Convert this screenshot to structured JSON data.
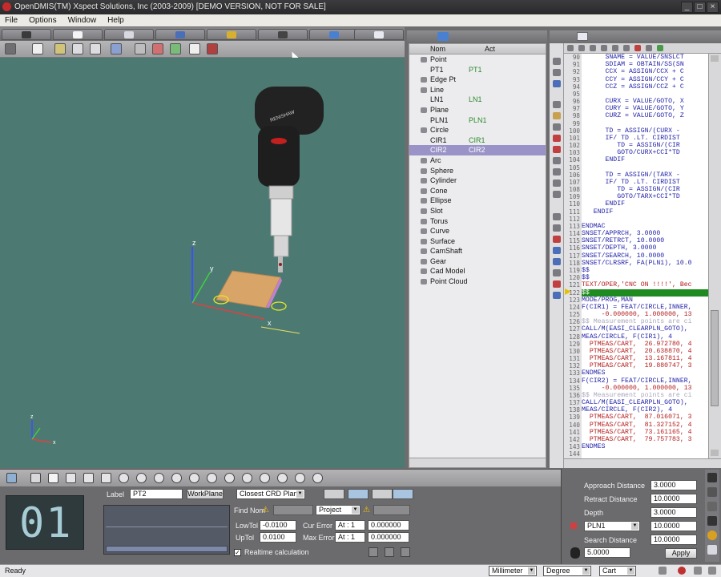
{
  "title": "OpenDMIS(TM) Xspect Solutions, Inc (2003-2009) [DEMO VERSION, NOT FOR SALE]",
  "menu": [
    "File",
    "Options",
    "Window",
    "Help"
  ],
  "tree": {
    "columns": {
      "name": "Nom",
      "act": "Act"
    },
    "rows": [
      {
        "name": "Point",
        "act": ""
      },
      {
        "name": "PT1",
        "act": "PT1"
      },
      {
        "name": "Edge Pt",
        "act": ""
      },
      {
        "name": "Line",
        "act": ""
      },
      {
        "name": "LN1",
        "act": "LN1"
      },
      {
        "name": "Plane",
        "act": ""
      },
      {
        "name": "PLN1",
        "act": "PLN1"
      },
      {
        "name": "Circle",
        "act": ""
      },
      {
        "name": "CIR1",
        "act": "CIR1"
      },
      {
        "name": "CIR2",
        "act": "CIR2"
      },
      {
        "name": "Arc",
        "act": ""
      },
      {
        "name": "Sphere",
        "act": ""
      },
      {
        "name": "Cylinder",
        "act": ""
      },
      {
        "name": "Cone",
        "act": ""
      },
      {
        "name": "Ellipse",
        "act": ""
      },
      {
        "name": "Slot",
        "act": ""
      },
      {
        "name": "Torus",
        "act": ""
      },
      {
        "name": "Curve",
        "act": ""
      },
      {
        "name": "Surface",
        "act": ""
      },
      {
        "name": "CamShaft",
        "act": ""
      },
      {
        "name": "Gear",
        "act": ""
      },
      {
        "name": "Cad Model",
        "act": ""
      },
      {
        "name": "Point Cloud",
        "act": ""
      }
    ]
  },
  "code": {
    "line_numbers": [
      "90",
      "91",
      "92",
      "93",
      "94",
      "95",
      "96",
      "97",
      "98",
      "99",
      "100",
      "101",
      "102",
      "103",
      "104",
      "105",
      "106",
      "107",
      "108",
      "109",
      "110",
      "111",
      "112",
      "113",
      "114",
      "115",
      "116",
      "117",
      "118",
      "119",
      "120",
      "121",
      "122",
      "123",
      "124",
      "125",
      "126",
      "127",
      "128",
      "129",
      "130",
      "131",
      "132",
      "133",
      "134",
      "135",
      "136",
      "137",
      "138",
      "139",
      "140",
      "141",
      "142",
      "143",
      "144"
    ],
    "lines": [
      "      SNAME = VALUE/SNSLCT",
      "      SDIAM = OBTAIN/SS(SN",
      "      CCX = ASSIGN/CCX + C",
      "      CCY = ASSIGN/CCY + C",
      "      CCZ = ASSIGN/CCZ + C",
      "",
      "      CURX = VALUE/GOTO, X",
      "      CURY = VALUE/GOTO, Y",
      "      CURZ = VALUE/GOTO, Z",
      "",
      "      TD = ASSIGN/(CURX -",
      "      IF/ TD .LT. CIRDIST",
      "         TD = ASSIGN/(CIR",
      "         GOTO/CURX+CCI*TD",
      "      ENDIF",
      "",
      "      TD = ASSIGN/(TARX -",
      "      IF/ TD .LT. CIRDIST",
      "         TD = ASSIGN/(CIR",
      "         GOTO/TARX+CCI*TD",
      "      ENDIF",
      "   ENDIF",
      "",
      "ENDMAC",
      "SNSET/APPRCH, 3.0000",
      "SNSET/RETRCT, 10.0000",
      "SNSET/DEPTH, 3.0000",
      "SNSET/SEARCH, 10.0000",
      "SNSET/CLRSRF, FA(PLN1), 10.0",
      "$$",
      "$$",
      "TEXT/OPER,'CNC ON !!!!', Bec",
      "$$",
      "MODE/PROG,MAN",
      "F(CIR1) = FEAT/CIRCLE,INNER,",
      "     -0.000000, 1.000000, 13",
      "$$ Measurement points are ci",
      "CALL/M(EASI_CLEARPLN_GOTO),",
      "MEAS/CIRCLE, F(CIR1), 4",
      "  PTMEAS/CART,  26.972780, 4",
      "  PTMEAS/CART,  20.638870, 4",
      "  PTMEAS/CART,  13.167811, 4",
      "  PTMEAS/CART,  19.880747, 3",
      "ENDMES",
      "F(CIR2) = FEAT/CIRCLE,INNER,",
      "     -0.000000, 1.000000, 13",
      "$$ Measurement points are ci",
      "CALL/M(EASI_CLEARPLN_GOTO),",
      "MEAS/CIRCLE, F(CIR2), 4",
      "  PTMEAS/CART,  87.016071, 3",
      "  PTMEAS/CART,  81.327152, 4",
      "  PTMEAS/CART,  73.161165, 4",
      "  PTMEAS/CART,  79.757783, 3",
      "ENDMES",
      ""
    ]
  },
  "viewport": {
    "probe_brand": "RENISHAW",
    "axis_x": "x",
    "axis_y": "y",
    "axis_z": "z",
    "mini_x": "x",
    "mini_z": "z"
  },
  "counter": {
    "digits": "01"
  },
  "feature": {
    "label_caption": "Label",
    "label_value": "PT2",
    "workplane_button": "WorkPlane",
    "plane_select": "Closest CRD Plane",
    "find_nom": "Find Nom",
    "project": "Project",
    "lowtol_label": "LowTol",
    "lowtol_value": "-0.0100",
    "uptol_label": "UpTol",
    "uptol_value": "0.0100",
    "cur_error_label": "Cur Error",
    "cur_error_at": "At : 1",
    "cur_error_value": "0.000000",
    "max_error_label": "Max Error",
    "max_error_at": "At : 1",
    "max_error_value": "0.000000",
    "realtime": "Realtime calculation"
  },
  "probe_settings": {
    "approach_label": "Approach Distance",
    "approach_value": "3.0000",
    "retract_label": "Retract Distance",
    "retract_value": "10.0000",
    "depth_label": "Depth",
    "depth_value": "3.0000",
    "plane_value": "PLN1",
    "clearance_value": "10.0000",
    "search_label": "Search Distance",
    "search_value": "10.0000",
    "extra_value": "5.0000",
    "apply": "Apply"
  },
  "status": {
    "text": "Ready",
    "unit": "Millimeter",
    "angle": "Degree",
    "coord": "Cart"
  },
  "colors": {
    "viewport_bg": "#4c7a72",
    "selection": "#9a93c8",
    "code_keyword": "#1f1fa8",
    "code_value": "#b41c1c",
    "code_highlight": "#1f8a1f"
  }
}
